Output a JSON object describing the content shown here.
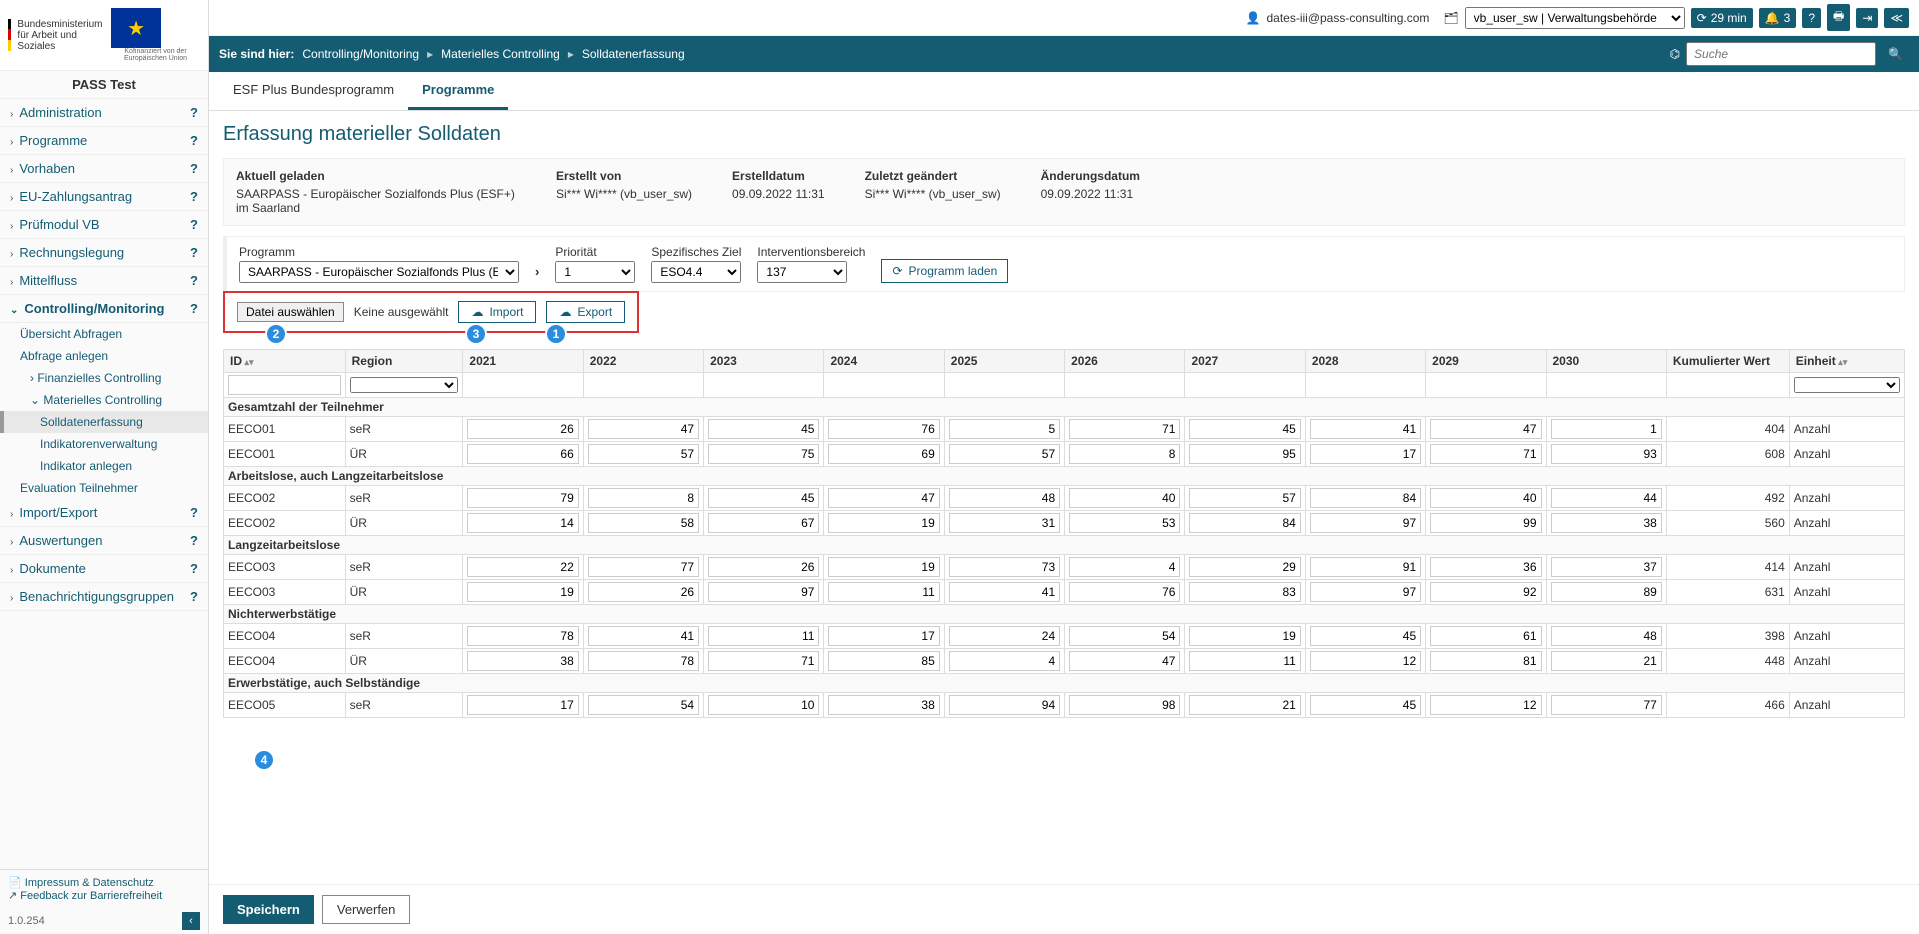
{
  "logo": {
    "ministry_line1": "Bundesministerium",
    "ministry_line2": "für Arbeit und Soziales",
    "eu_caption": "Kofinanziert von der Europäischen Union"
  },
  "pass_test": "PASS Test",
  "nav": {
    "items": [
      "Administration",
      "Programme",
      "Vorhaben",
      "EU-Zahlungsantrag",
      "Prüfmodul VB",
      "Rechnungslegung",
      "Mittelfluss",
      "Controlling/Monitoring",
      "Import/Export",
      "Auswertungen",
      "Dokumente",
      "Benachrichtigungsgruppen"
    ],
    "expanded_index": 7,
    "sub": {
      "uebersicht": "Übersicht Abfragen",
      "anlegen": "Abfrage anlegen",
      "fin": "Finanzielles Controlling",
      "mat": "Materielles Controlling",
      "soll": "Solldatenerfassung",
      "indverw": "Indikatorenverwaltung",
      "indanl": "Indikator anlegen",
      "eval": "Evaluation Teilnehmer"
    }
  },
  "footer": {
    "impressum": "Impressum & Datenschutz",
    "feedback": "Feedback zur Barrierefreiheit",
    "version": "1.0.254"
  },
  "topbar": {
    "user": "dates-iii@pass-consulting.com",
    "role_select": "vb_user_sw | Verwaltungsbehörde",
    "timer": "29 min",
    "notif_count": "3"
  },
  "crumbs": {
    "prefix": "Sie sind hier:",
    "c1": "Controlling/Monitoring",
    "c2": "Materielles Controlling",
    "c3": "Solldatenerfassung",
    "search_ph": "Suche"
  },
  "tabs": {
    "t1": "ESF Plus Bundesprogramm",
    "t2": "Programme"
  },
  "title": "Erfassung materieller Solldaten",
  "info": {
    "loaded_lab": "Aktuell geladen",
    "loaded_val": "SAARPASS - Europäischer Sozialfonds Plus (ESF+) im Saarland",
    "created_by_lab": "Erstellt von",
    "created_by_val": "Si*** Wi**** (vb_user_sw)",
    "created_on_lab": "Erstelldatum",
    "created_on_val": "09.09.2022 11:31",
    "changed_by_lab": "Zuletzt geändert",
    "changed_by_val": "Si*** Wi**** (vb_user_sw)",
    "changed_on_lab": "Änderungsdatum",
    "changed_on_val": "09.09.2022 11:31"
  },
  "filters": {
    "programm_lab": "Programm",
    "programm_val": "SAARPASS - Europäischer Sozialfonds Plus (ESF+) im S",
    "prio_lab": "Priorität",
    "prio_val": "1",
    "ziel_lab": "Spezifisches Ziel",
    "ziel_val": "ESO4.4",
    "bereich_lab": "Interventionsbereich",
    "bereich_val": "137",
    "load_btn": "Programm laden",
    "file_btn": "Datei auswählen",
    "file_lbl": "Keine ausgewählt",
    "import_btn": "Import",
    "export_btn": "Export"
  },
  "annot": {
    "a1": "1",
    "a2": "2",
    "a3": "3",
    "a4": "4"
  },
  "headers": {
    "id": "ID",
    "region": "Region",
    "kum": "Kumulierter Wert",
    "ein": "Einheit"
  },
  "years": [
    "2021",
    "2022",
    "2023",
    "2024",
    "2025",
    "2026",
    "2027",
    "2028",
    "2029",
    "2030"
  ],
  "groups": [
    {
      "title": "Gesamtzahl der Teilnehmer",
      "rows": [
        {
          "id": "EECO01",
          "reg": "seR",
          "v": [
            "26",
            "47",
            "45",
            "76",
            "5",
            "71",
            "45",
            "41",
            "47",
            "1"
          ],
          "kum": "404",
          "ein": "Anzahl"
        },
        {
          "id": "EECO01",
          "reg": "ÜR",
          "v": [
            "66",
            "57",
            "75",
            "69",
            "57",
            "8",
            "95",
            "17",
            "71",
            "93"
          ],
          "kum": "608",
          "ein": "Anzahl"
        }
      ]
    },
    {
      "title": "Arbeitslose, auch Langzeitarbeitslose",
      "rows": [
        {
          "id": "EECO02",
          "reg": "seR",
          "v": [
            "79",
            "8",
            "45",
            "47",
            "48",
            "40",
            "57",
            "84",
            "40",
            "44"
          ],
          "kum": "492",
          "ein": "Anzahl"
        },
        {
          "id": "EECO02",
          "reg": "ÜR",
          "v": [
            "14",
            "58",
            "67",
            "19",
            "31",
            "53",
            "84",
            "97",
            "99",
            "38"
          ],
          "kum": "560",
          "ein": "Anzahl"
        }
      ]
    },
    {
      "title": "Langzeitarbeitslose",
      "rows": [
        {
          "id": "EECO03",
          "reg": "seR",
          "v": [
            "22",
            "77",
            "26",
            "19",
            "73",
            "4",
            "29",
            "91",
            "36",
            "37"
          ],
          "kum": "414",
          "ein": "Anzahl"
        },
        {
          "id": "EECO03",
          "reg": "ÜR",
          "v": [
            "19",
            "26",
            "97",
            "11",
            "41",
            "76",
            "83",
            "97",
            "92",
            "89"
          ],
          "kum": "631",
          "ein": "Anzahl"
        }
      ]
    },
    {
      "title": "Nichterwerbstätige",
      "rows": [
        {
          "id": "EECO04",
          "reg": "seR",
          "v": [
            "78",
            "41",
            "11",
            "17",
            "24",
            "54",
            "19",
            "45",
            "61",
            "48"
          ],
          "kum": "398",
          "ein": "Anzahl"
        },
        {
          "id": "EECO04",
          "reg": "ÜR",
          "v": [
            "38",
            "78",
            "71",
            "85",
            "4",
            "47",
            "11",
            "12",
            "81",
            "21"
          ],
          "kum": "448",
          "ein": "Anzahl"
        }
      ]
    },
    {
      "title": "Erwerbstätige, auch Selbständige",
      "rows": [
        {
          "id": "EECO05",
          "reg": "seR",
          "v": [
            "17",
            "54",
            "10",
            "38",
            "94",
            "98",
            "21",
            "45",
            "12",
            "77"
          ],
          "kum": "466",
          "ein": "Anzahl"
        }
      ]
    }
  ],
  "actions": {
    "save": "Speichern",
    "discard": "Verwerfen"
  }
}
